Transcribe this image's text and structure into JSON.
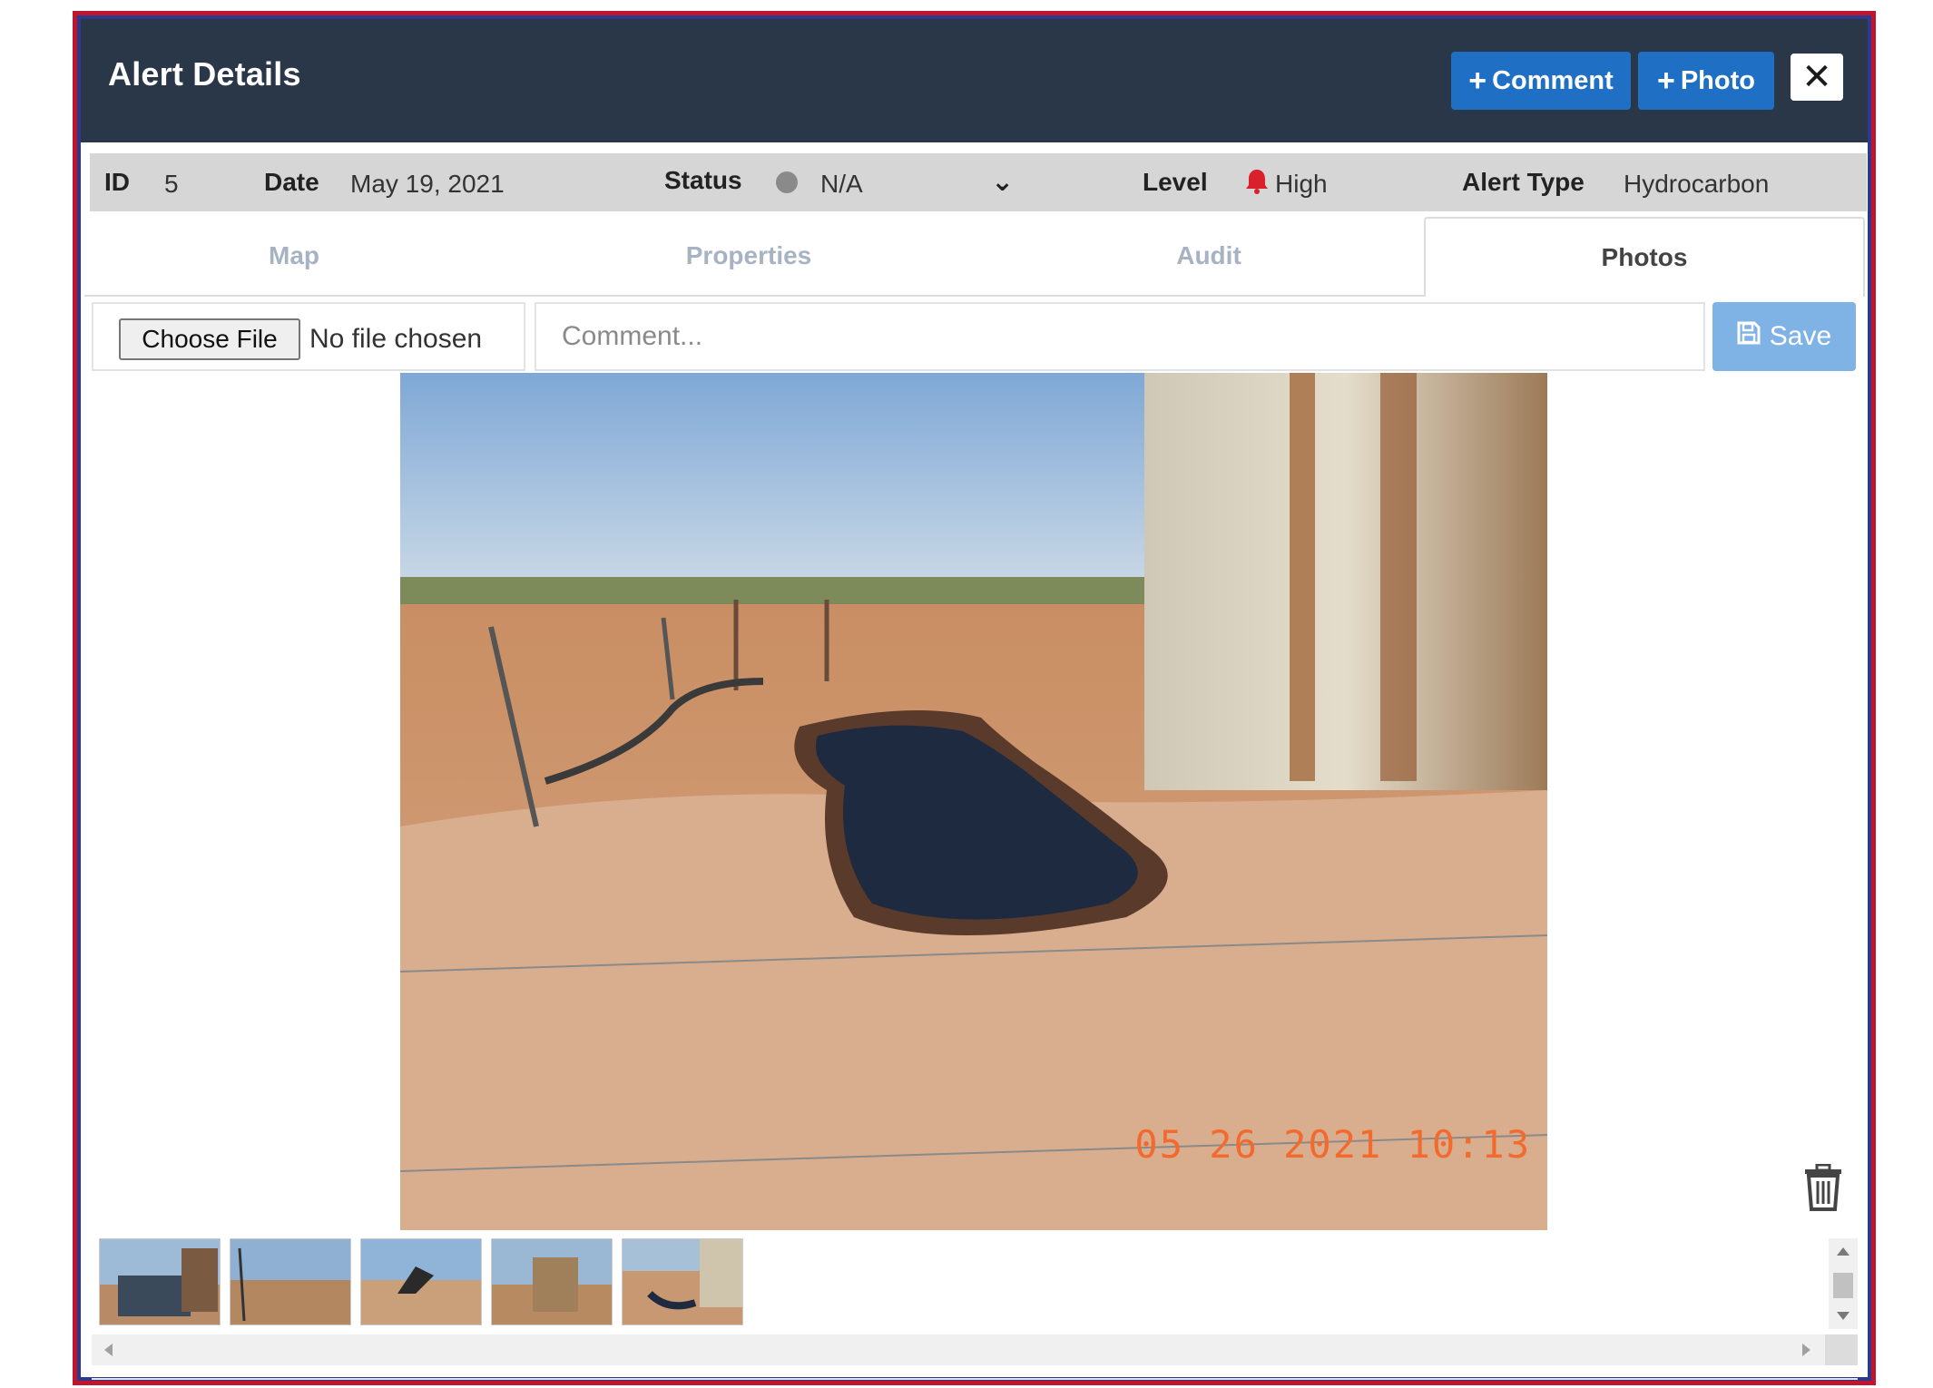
{
  "header": {
    "title": "Alert Details",
    "comment_button": "Comment",
    "photo_button": "Photo",
    "close_icon": "close-icon"
  },
  "info": {
    "id_label": "ID",
    "id_value": "5",
    "date_label": "Date",
    "date_value": "May 19, 2021",
    "status_label": "Status",
    "status_value": "N/A",
    "level_label": "Level",
    "level_value": "High",
    "alert_type_label": "Alert Type",
    "alert_type_value": "Hydrocarbon",
    "colors": {
      "status_dot": "#8a8a8a",
      "level_bell": "#d9202b"
    }
  },
  "tabs": [
    {
      "label": "Map",
      "active": false
    },
    {
      "label": "Properties",
      "active": false
    },
    {
      "label": "Audit",
      "active": false
    },
    {
      "label": "Photos",
      "active": true
    }
  ],
  "upload": {
    "choose_file_label": "Choose File",
    "no_file_text": "No file chosen",
    "comment_placeholder": "Comment...",
    "save_label": "Save"
  },
  "photo": {
    "stamp": "05 26 2021  10:13"
  },
  "thumbnails": [
    {
      "name": "thumbnail-1"
    },
    {
      "name": "thumbnail-2"
    },
    {
      "name": "thumbnail-3"
    },
    {
      "name": "thumbnail-4"
    },
    {
      "name": "thumbnail-5"
    }
  ],
  "colors": {
    "header_bg": "#2a3749",
    "primary_button": "#1f6fc4",
    "save_button": "#7fb2e5",
    "info_bar_bg": "#d6d6d6",
    "frame_red": "#c0152f",
    "frame_blue": "#2b3a8c"
  }
}
